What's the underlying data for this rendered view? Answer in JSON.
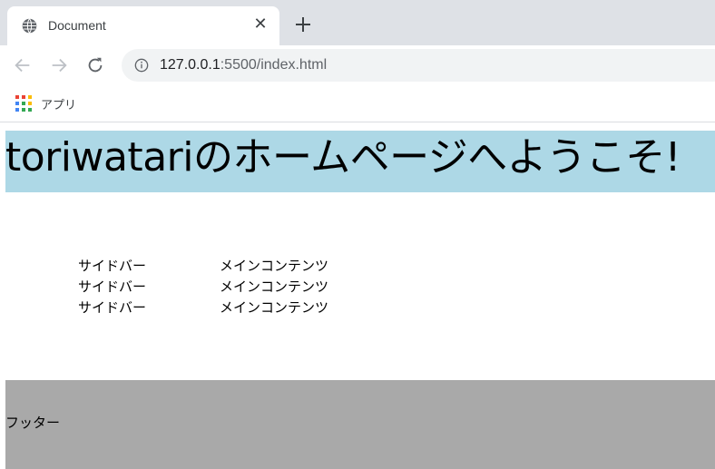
{
  "browser": {
    "tab_title": "Document",
    "tab_close_glyph": "✕",
    "url_host": "127.0.0.1",
    "url_rest": ":5500/index.html",
    "bookmark_apps_label": "アプリ"
  },
  "page": {
    "heading": "toriwatariのホームページへようこそ!",
    "sidebar_items": [
      "サイドバー",
      "サイドバー",
      "サイドバー"
    ],
    "main_items": [
      "メインコンテンツ",
      "メインコンテンツ",
      "メインコンテンツ"
    ],
    "footer": "フッター"
  },
  "colors": {
    "hero_bg": "#add8e6",
    "footer_bg": "#a9a9a9",
    "tabstrip_bg": "#dee1e6"
  }
}
